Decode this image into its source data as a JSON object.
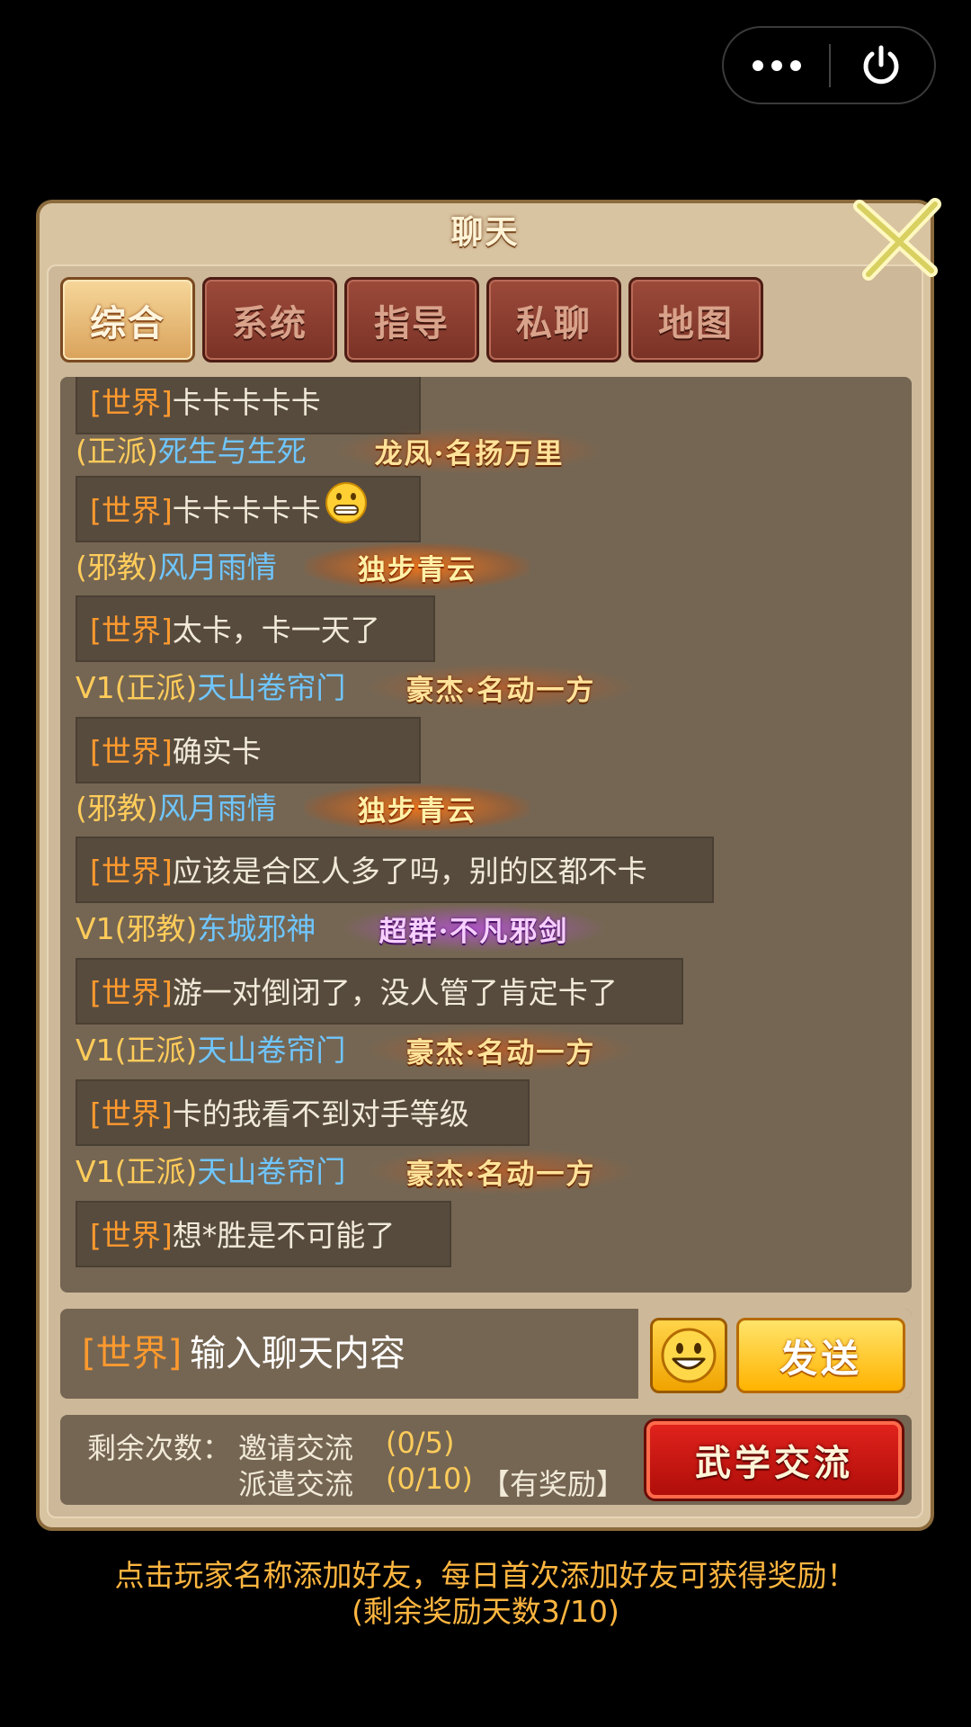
{
  "capsule": {
    "menu_icon": "more-dots-icon",
    "power_icon": "power-icon"
  },
  "panel": {
    "title": "聊天"
  },
  "tabs": [
    {
      "label": "综合",
      "active": true
    },
    {
      "label": "系统",
      "active": false
    },
    {
      "label": "指导",
      "active": false
    },
    {
      "label": "私聊",
      "active": false
    },
    {
      "label": "地图",
      "active": false
    }
  ],
  "chat": {
    "messages": [
      {
        "type": "text",
        "channel": "[世界]",
        "text": "卡卡卡卡卡"
      },
      {
        "type": "sender",
        "vip": "",
        "faction": "(正派)",
        "name": "死生与生死",
        "badge": "龙凤·名扬万里"
      },
      {
        "type": "text",
        "channel": "[世界]",
        "text": "卡卡卡卡卡",
        "emoji": "grin-emoji-icon"
      },
      {
        "type": "sender",
        "vip": "",
        "faction": "(邪教)",
        "name": "风月雨情",
        "badge": "独步青云"
      },
      {
        "type": "text",
        "channel": "[世界]",
        "text": "太卡，卡一天了"
      },
      {
        "type": "sender",
        "vip": "V1",
        "faction": "(正派)",
        "name": "天山卷帘门",
        "badge": "豪杰·名动一方"
      },
      {
        "type": "text",
        "channel": "[世界]",
        "text": "确实卡"
      },
      {
        "type": "sender",
        "vip": "",
        "faction": "(邪教)",
        "name": "风月雨情",
        "badge": "独步青云"
      },
      {
        "type": "text",
        "channel": "[世界]",
        "text": "应该是合区人多了吗，别的区都不卡"
      },
      {
        "type": "sender",
        "vip": "V1",
        "faction": "(邪教)",
        "name": "东城邪神",
        "badge": "超群·不凡邪剑"
      },
      {
        "type": "text",
        "channel": "[世界]",
        "text": "游一对倒闭了，没人管了肯定卡了"
      },
      {
        "type": "sender",
        "vip": "V1",
        "faction": "(正派)",
        "name": "天山卷帘门",
        "badge": "豪杰·名动一方"
      },
      {
        "type": "text",
        "channel": "[世界]",
        "text": "卡的我看不到对手等级"
      },
      {
        "type": "sender",
        "vip": "V1",
        "faction": "(正派)",
        "name": "天山卷帘门",
        "badge": "豪杰·名动一方"
      },
      {
        "type": "text",
        "channel": "[世界]",
        "text": "想*胜是不可能了"
      }
    ]
  },
  "input": {
    "channel": "[世界]",
    "placeholder": "输入聊天内容",
    "emoji_icon": "smiley-icon",
    "send_label": "发送"
  },
  "exchange": {
    "remaining_label": "剩余次数：",
    "invite_label": "邀请交流",
    "invite_count": "(0/5)",
    "dispatch_label": "派遣交流",
    "dispatch_count": "(0/10)",
    "reward_note": "【有奖励】",
    "button_label": "武学交流"
  },
  "footer": {
    "line1": "点击玩家名称添加好友，每日首次添加好友可获得奖励！",
    "line2": "(剩余奖励天数3/10)"
  },
  "colors": {
    "channel": "#ff9a2e",
    "player_name": "#6fc6ff",
    "faction": "#ffcc5a",
    "hint": "#ffb640"
  }
}
